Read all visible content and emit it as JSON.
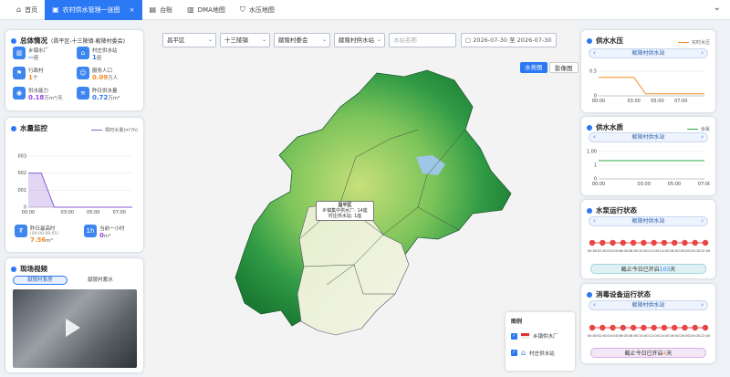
{
  "tabs": [
    {
      "label": "首页",
      "icon": "home-icon",
      "active": false
    },
    {
      "label": "农村供水管理一张图",
      "icon": "map-icon",
      "active": true,
      "closable": true
    },
    {
      "label": "台账",
      "icon": "ledger-icon",
      "active": false
    },
    {
      "label": "DMA地图",
      "icon": "dma-map-icon",
      "active": false
    },
    {
      "label": "水压地图",
      "icon": "pressure-map-icon",
      "active": false
    }
  ],
  "tab_close": "×",
  "tab_menu": "⌄",
  "filters": {
    "district": "昌平区",
    "town": "十三陵镇",
    "village": "献陵村委会",
    "station": "献陵村供水站",
    "station_name_placeholder": "水站名称",
    "date_from": "2026-07-30",
    "date_to": "2026-07-30",
    "date_sep": "至"
  },
  "map_buttons": {
    "water_map": "水务图",
    "satellite": "影像图"
  },
  "map_callout": {
    "title": "昌平区",
    "line1": "乡镇集中供水厂: 14座",
    "line2": "村庄供水站: 1座"
  },
  "map_legend": {
    "title": "图例",
    "items": [
      "乡镇供水厂",
      "村庄供水站"
    ]
  },
  "overview": {
    "title": "总体情况",
    "subtitle": "(昌平区-十三陵镇-献陵村委会)",
    "stats": [
      {
        "label": "乡镇水厂",
        "value": "--",
        "unit": "座",
        "icon": "factory-icon",
        "color": "#2b78f5"
      },
      {
        "label": "村庄供水站",
        "value": "1",
        "unit": "座",
        "icon": "station-icon",
        "color": "#2b78f5"
      },
      {
        "label": "行政村",
        "value": "1",
        "unit": "个",
        "icon": "village-icon",
        "color": "#f08a24"
      },
      {
        "label": "服务人口",
        "value": "0.09",
        "unit": "万人",
        "icon": "people-icon",
        "color": "#f08a24"
      },
      {
        "label": "供水能力",
        "value": "0.18",
        "unit": "万m³/天",
        "icon": "capacity-icon",
        "color": "#8e44ec"
      },
      {
        "label": "昨日供水量",
        "value": "0.72",
        "unit": "万m³",
        "icon": "supply-volume-icon",
        "color": "#2b78f5"
      }
    ]
  },
  "water_monitor": {
    "title": "水量监控",
    "legend": "瞬时水量(m³/h)",
    "yesterday_label": "昨日最高时",
    "yesterday_time": "(09:00-09:05)",
    "yesterday_value": "7.56",
    "yesterday_unit": "m³",
    "lasthour_label": "当前一小时",
    "lasthour_value": "0",
    "lasthour_unit": "m³",
    "lasthour_icon_text": "1h"
  },
  "video": {
    "title": "现场视频",
    "tabs": [
      "献陵村泵房",
      "献陵村蓄水"
    ]
  },
  "pressure": {
    "title": "供水水压",
    "legend": "实时水压",
    "station": "献陵村供水站"
  },
  "quality": {
    "title": "供水水质",
    "legend": "余氯",
    "station": "献陵村供水站"
  },
  "pump": {
    "title": "水泵运行状态",
    "station": "献陵村供水站",
    "footer_prefix": "截止今日已开启",
    "footer_count": "103",
    "footer_suffix": "天"
  },
  "disinfect": {
    "title": "消毒设备运行状态",
    "station": "献陵村供水站",
    "footer_prefix": "截止今日已开启",
    "footer_count": "4",
    "footer_suffix": "天"
  },
  "chart_data": [
    {
      "type": "area",
      "name": "water_monitor",
      "series": [
        {
          "name": "瞬时水量(m³/h)",
          "color": "#8a5bd6"
        }
      ],
      "x": [
        "00:00",
        "01:00",
        "02:00",
        "03:00",
        "04:00",
        "05:00",
        "06:00",
        "07:00",
        "08:00"
      ],
      "values": [
        0.002,
        0.002,
        0,
        0,
        0,
        0,
        0,
        0,
        0
      ],
      "xticks": [
        "00:00",
        "03:00",
        "05:00",
        "07:00"
      ],
      "yticks": [
        "003",
        "002",
        "001",
        "0"
      ],
      "ylim": [
        0,
        0.003
      ]
    },
    {
      "type": "line",
      "name": "pressure",
      "series": [
        {
          "name": "实时水压",
          "color": "#f08a24"
        }
      ],
      "x": [
        "00:00",
        "01:00",
        "02:00",
        "03:00",
        "04:00",
        "05:00",
        "06:00",
        "07:00",
        "08:00",
        "09:00"
      ],
      "values": [
        0.45,
        0.45,
        0.45,
        0.45,
        0.05,
        0.05,
        0.05,
        0.05,
        0.05,
        0.05
      ],
      "xticks": [
        "00:00",
        "03:00",
        "05:00",
        "07:00"
      ],
      "yticks": [
        "0.5",
        "0"
      ],
      "ylim": [
        0,
        0.6
      ]
    },
    {
      "type": "line",
      "name": "quality",
      "series": [
        {
          "name": "余氯",
          "color": "#2aa84a"
        }
      ],
      "x": [
        "00:00",
        "01:00",
        "02:00",
        "03:00",
        "04:00",
        "05:00",
        "06:00",
        "07:00"
      ],
      "values": [
        1.0,
        1.0,
        1.0,
        1.0,
        1.0,
        1.0,
        1.0,
        1.0
      ],
      "xticks": [
        "00:00",
        "03:00",
        "05:00",
        "07:00"
      ],
      "yticks": [
        "1.00",
        "1",
        "0"
      ],
      "ylim": [
        0,
        1.5
      ]
    }
  ],
  "pump_status": {
    "count": 12,
    "times": [
      "00:00",
      "02:00",
      "04:00",
      "06:00",
      "08:00",
      "10:00",
      "12:00",
      "14:00",
      "16:00",
      "18:00",
      "20:00",
      "22:00"
    ],
    "color": "#e84545"
  },
  "disinfect_status": {
    "count": 12,
    "times": [
      "00:00",
      "02:00",
      "04:00",
      "06:00",
      "08:00",
      "10:00",
      "12:00",
      "14:00",
      "16:00",
      "18:00",
      "20:00",
      "22:00"
    ],
    "color": "#e84545"
  }
}
